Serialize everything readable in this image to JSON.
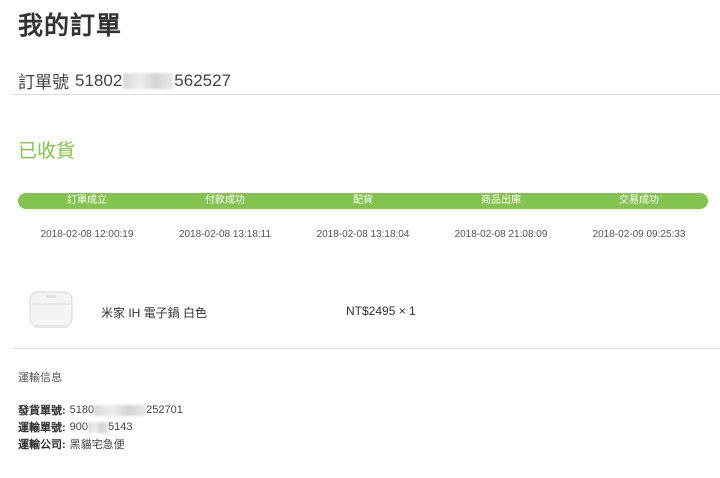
{
  "page": {
    "title": "我的訂單"
  },
  "order": {
    "label": "訂單號",
    "number_prefix": "51802",
    "number_suffix": "562527"
  },
  "status": {
    "text": "已收貨"
  },
  "progress": {
    "steps": [
      "訂單成立",
      "付款成功",
      "配貨",
      "商品出庫",
      "交易成功"
    ],
    "timestamps": [
      "2018-02-08 12:00:19",
      "2018-02-08 13:18:11",
      "2018-02-08 13:18:04",
      "2018-02-08 21:08:09",
      "2018-02-09 09:25:33"
    ]
  },
  "product": {
    "name": "米家 IH 電子鍋 白色",
    "price": "NT$2495 × 1",
    "image_icon": "rice-cooker-image"
  },
  "shipping": {
    "title": "運輸信息",
    "shipment_label": "發貨單號:",
    "shipment_prefix": "5180",
    "shipment_suffix": "252701",
    "tracking_label": "運輸單號:",
    "tracking_prefix": "900",
    "tracking_suffix": "5143",
    "company_label": "運輸公司:",
    "company_value": "黑貓宅急便"
  },
  "colors": {
    "accent": "#83c44e",
    "text": "#333333",
    "divider": "#dddddd"
  }
}
